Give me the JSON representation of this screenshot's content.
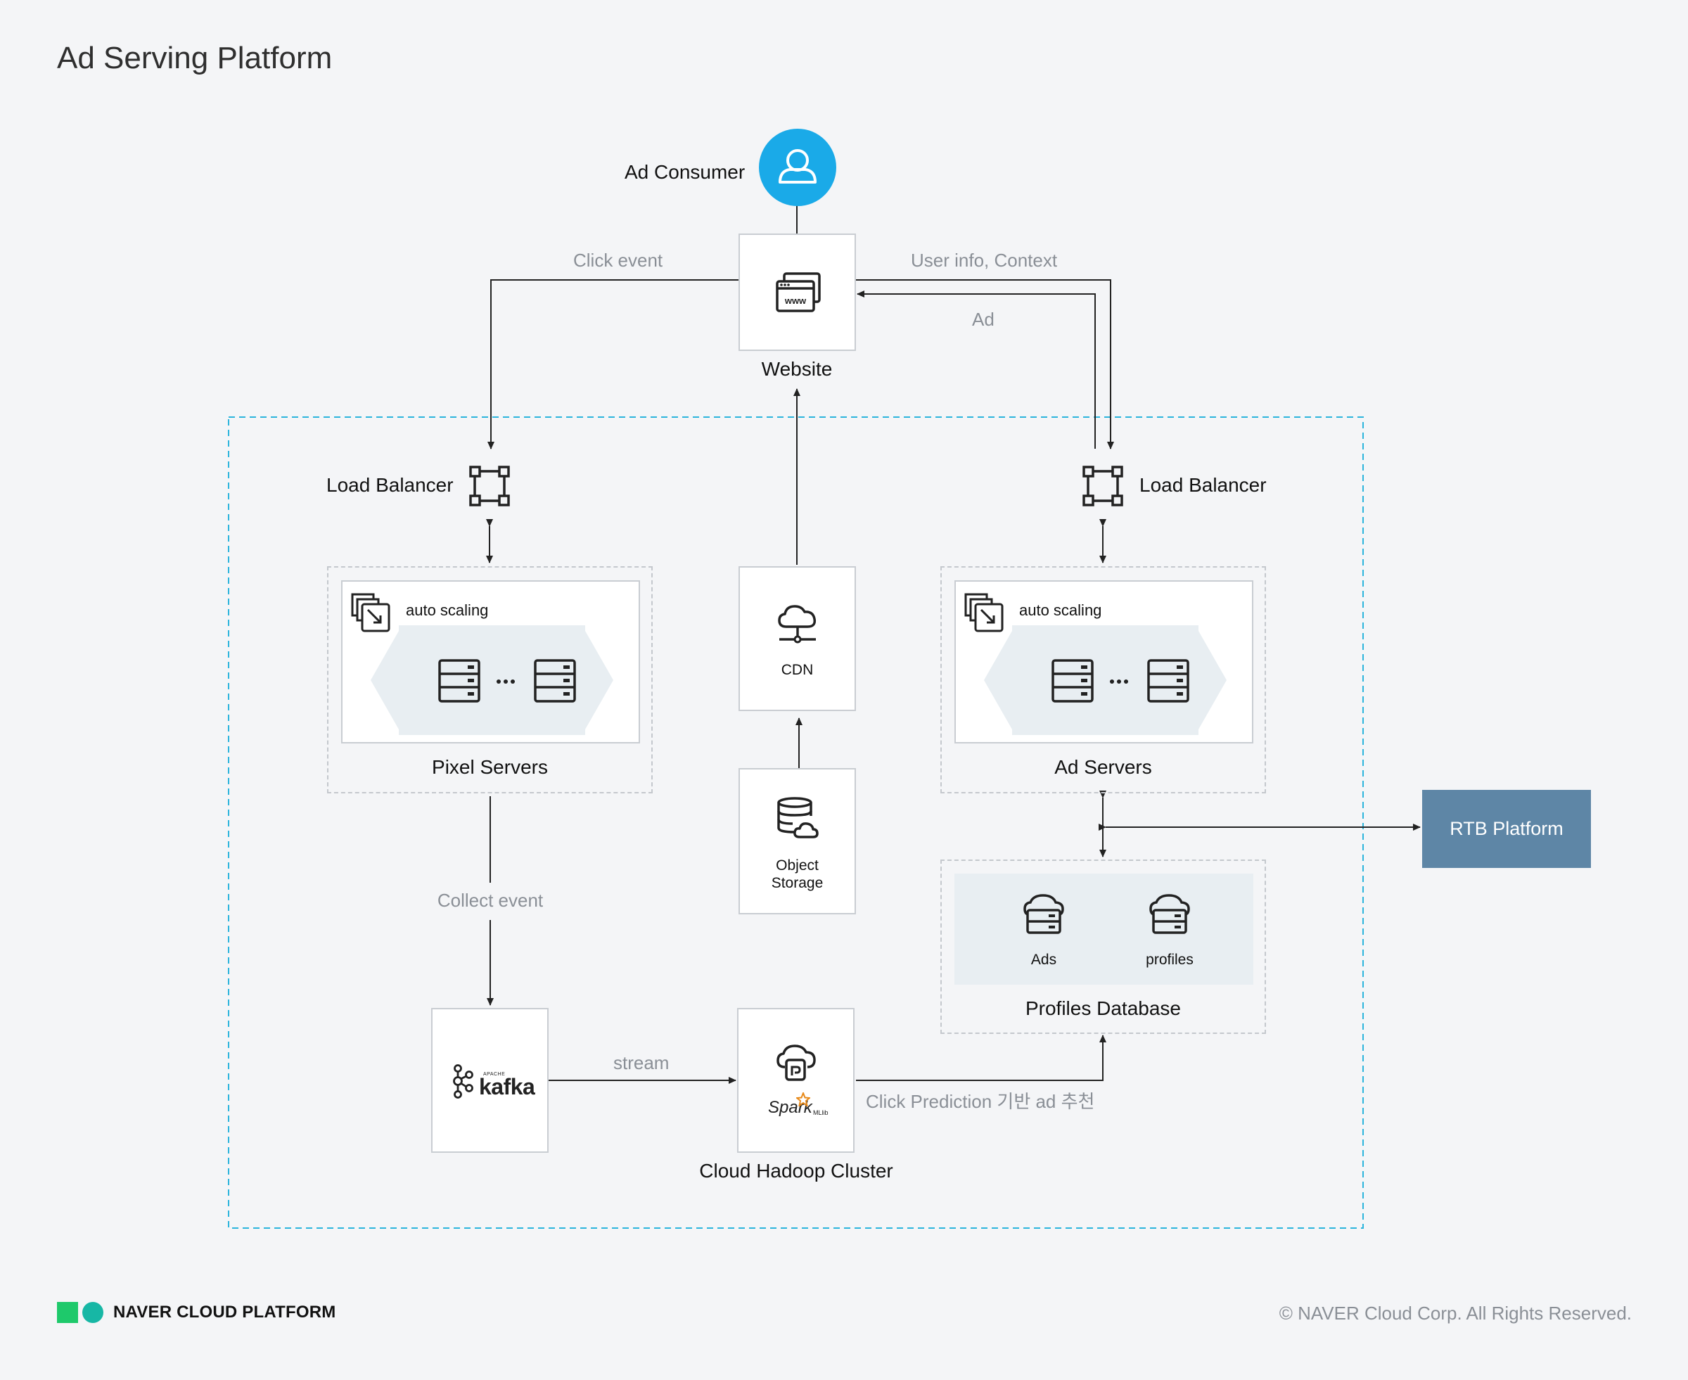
{
  "title": "Ad Serving Platform",
  "nodes": {
    "ad_consumer": "Ad Consumer",
    "website": "Website",
    "lb_left": "Load Balancer",
    "lb_right": "Load Balancer",
    "auto_scaling_left": "auto scaling",
    "auto_scaling_right": "auto scaling",
    "pixel_servers": "Pixel Servers",
    "ad_servers": "Ad Servers",
    "cdn": "CDN",
    "object_storage_line1": "Object",
    "object_storage_line2": "Storage",
    "rtb_platform": "RTB Platform",
    "db_ads": "Ads",
    "db_profiles": "profiles",
    "profiles_database": "Profiles Database",
    "kafka_small": "APACHE",
    "kafka": "kafka",
    "spark": "Spark",
    "mllib": "MLlib",
    "hadoop_cluster": "Cloud Hadoop Cluster",
    "www": "www"
  },
  "edges": {
    "click_event": "Click event",
    "user_info_context": "User info, Context",
    "ad": "Ad",
    "collect_event": "Collect event",
    "stream": "stream",
    "click_prediction": "Click Prediction 기반 ad 추천"
  },
  "footer": {
    "brand": "NAVER CLOUD PLATFORM",
    "copyright": "© NAVER Cloud Corp. All Rights Reserved."
  },
  "colors": {
    "accent_blue": "#1aaae8",
    "rtb_blue": "#5e86a6",
    "brand_green": "#1ec96b",
    "brand_teal": "#17b7a5",
    "dashed_border_blue": "#2bb4dc"
  }
}
